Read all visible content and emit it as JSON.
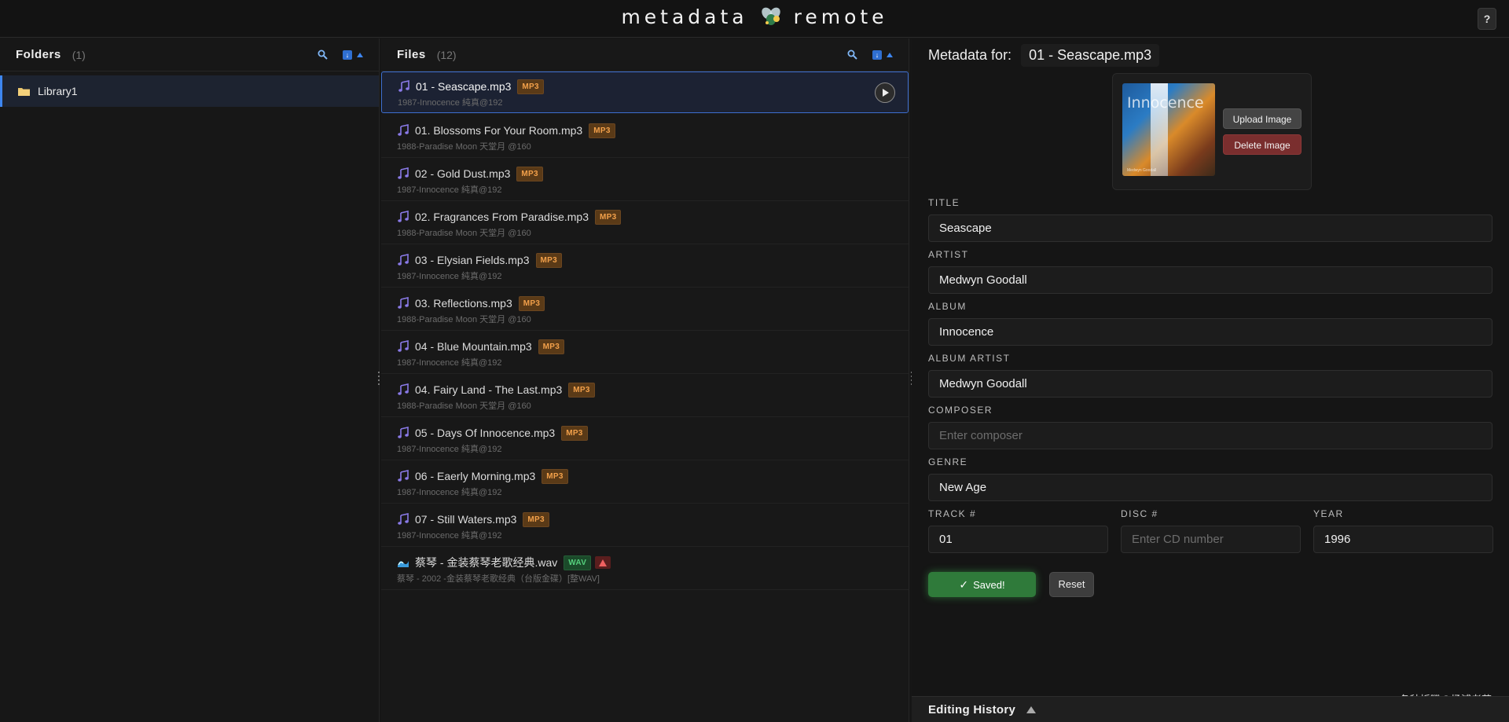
{
  "app": {
    "title_left": "metadata",
    "title_right": "remote",
    "help_label": "?"
  },
  "folders": {
    "title": "Folders",
    "count": "(1)",
    "items": [
      {
        "label": "Library1"
      }
    ]
  },
  "files": {
    "title": "Files",
    "count": "(12)",
    "items": [
      {
        "name": "01 - Seascape.mp3",
        "format": "MP3",
        "sub": "1987-Innocence 純真@192"
      },
      {
        "name": "01. Blossoms For Your Room.mp3",
        "format": "MP3",
        "sub": "1988-Paradise Moon 天堂月 @160"
      },
      {
        "name": "02 - Gold Dust.mp3",
        "format": "MP3",
        "sub": "1987-Innocence 純真@192"
      },
      {
        "name": "02. Fragrances From Paradise.mp3",
        "format": "MP3",
        "sub": "1988-Paradise Moon 天堂月 @160"
      },
      {
        "name": "03 - Elysian Fields.mp3",
        "format": "MP3",
        "sub": "1987-Innocence 純真@192"
      },
      {
        "name": "03. Reflections.mp3",
        "format": "MP3",
        "sub": "1988-Paradise Moon 天堂月 @160"
      },
      {
        "name": "04 - Blue Mountain.mp3",
        "format": "MP3",
        "sub": "1987-Innocence 純真@192"
      },
      {
        "name": "04. Fairy Land - The Last.mp3",
        "format": "MP3",
        "sub": "1988-Paradise Moon 天堂月 @160"
      },
      {
        "name": "05 - Days Of Innocence.mp3",
        "format": "MP3",
        "sub": "1987-Innocence 純真@192"
      },
      {
        "name": "06 - Eaerly Morning.mp3",
        "format": "MP3",
        "sub": "1987-Innocence 純真@192"
      },
      {
        "name": "07 - Still Waters.mp3",
        "format": "MP3",
        "sub": "1987-Innocence 純真@192"
      },
      {
        "name": "蔡琴 - 金装蔡琴老歌经典.wav",
        "format": "WAV",
        "sub": "蔡琴 - 2002 -金装蔡琴老歌经典（台版金碟）[整WAV]"
      }
    ]
  },
  "metadata": {
    "header_label": "Metadata for:",
    "file_name": "01 - Seascape.mp3",
    "cover_text": "Innocence",
    "cover_sub": "Medwyn Goodall",
    "upload_label": "Upload Image",
    "delete_label": "Delete Image",
    "fields": {
      "title": {
        "label": "TITLE",
        "value": "Seascape"
      },
      "artist": {
        "label": "ARTIST",
        "value": "Medwyn Goodall"
      },
      "album": {
        "label": "ALBUM",
        "value": "Innocence"
      },
      "album_artist": {
        "label": "ALBUM ARTIST",
        "value": "Medwyn Goodall"
      },
      "composer": {
        "label": "COMPOSER",
        "placeholder": "Enter composer"
      },
      "genre": {
        "label": "GENRE",
        "value": "New Age"
      },
      "track": {
        "label": "TRACK #",
        "value": "01"
      },
      "disc": {
        "label": "DISC #",
        "placeholder": "Enter CD number"
      },
      "year": {
        "label": "YEAR",
        "value": "1996"
      }
    },
    "saved_label": "Saved!",
    "reset_label": "Reset",
    "history_label": "Editing History",
    "watermark": "各种折腾@杨浦老苏"
  },
  "colors": {
    "accent": "#3d86f0",
    "mp3_badge": "#f2a04a",
    "wav_badge": "#56d07d",
    "saved": "#2f7a3a",
    "delete": "#7a2e2e"
  }
}
